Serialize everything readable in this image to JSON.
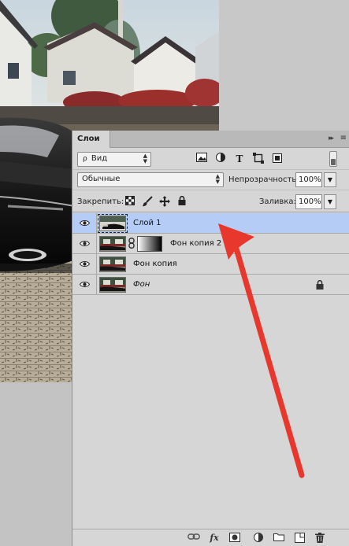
{
  "layers_panel": {
    "tab_title": "Слои",
    "collapse_glyph": "▸▸",
    "menu_glyph": "≡",
    "filter": {
      "search_glyph": "ρ",
      "kind_label": "Вид",
      "icons": [
        "image-filter-icon",
        "adjustment-filter-icon",
        "type-filter-icon",
        "shape-filter-icon",
        "smart-object-filter-icon"
      ]
    },
    "blend_mode": "Обычные",
    "opacity_label": "Непрозрачность:",
    "opacity_value": "100%",
    "lock_label": "Закрепить:",
    "fill_label": "Заливка:",
    "fill_value": "100%",
    "layers": [
      {
        "name": "Слой 1",
        "selected": true,
        "italic": false,
        "has_mask": false,
        "locked": false
      },
      {
        "name": "Фон копия 2",
        "selected": false,
        "italic": false,
        "has_mask": true,
        "locked": false
      },
      {
        "name": "Фон копия",
        "selected": false,
        "italic": false,
        "has_mask": false,
        "locked": false
      },
      {
        "name": "Фон",
        "selected": false,
        "italic": true,
        "has_mask": false,
        "locked": true
      }
    ],
    "bottom_icons": [
      "link-layers-icon",
      "fx-icon",
      "add-mask-icon",
      "adjustment-layer-icon",
      "new-group-icon",
      "new-layer-icon",
      "delete-layer-icon"
    ],
    "fx_label": "fx"
  },
  "colors": {
    "panel_bg": "#d6d6d6",
    "selected_row": "#b5cdf6",
    "annotation_arrow": "#e8372c"
  }
}
